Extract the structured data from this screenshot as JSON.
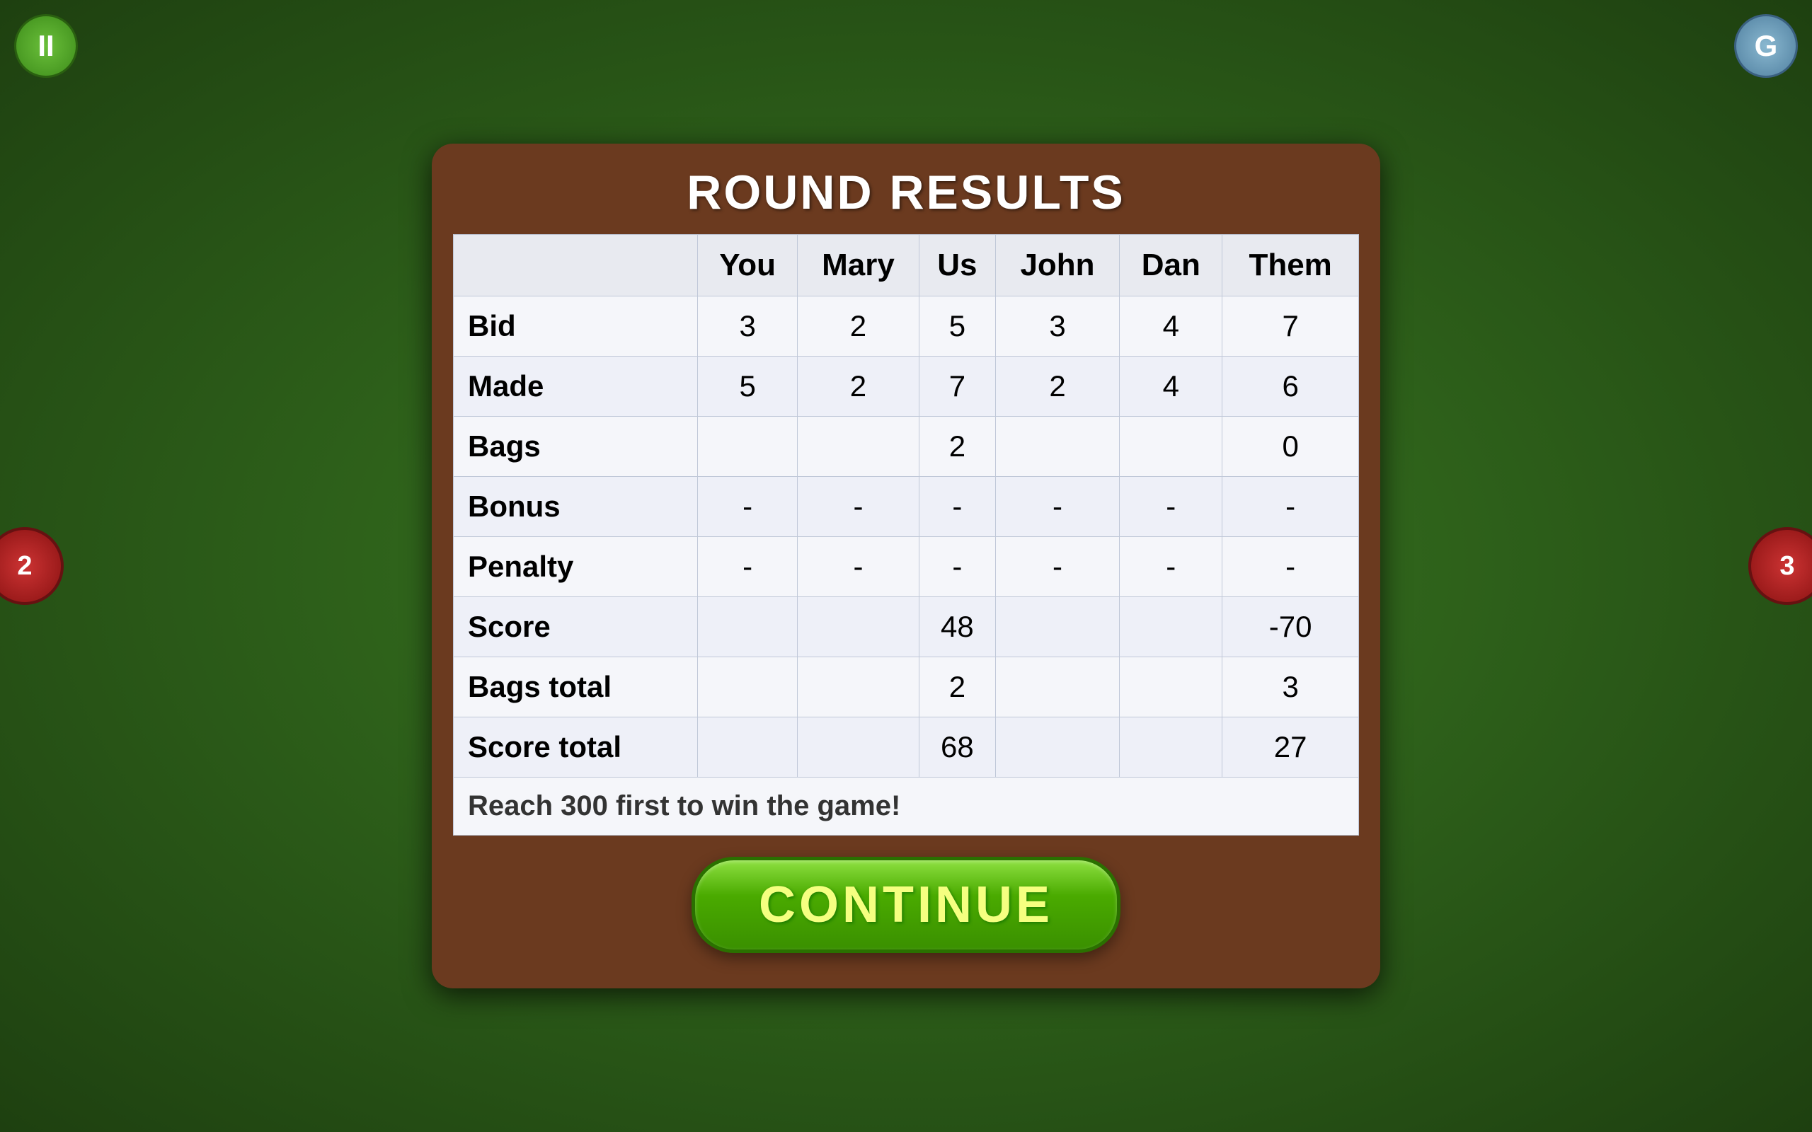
{
  "background": {
    "color": "#2d5a1b"
  },
  "corner_buttons": {
    "top_left": {
      "label": "II",
      "color": "#4aaa10"
    },
    "top_right": {
      "label": "G",
      "color": "#6090b0"
    }
  },
  "modal": {
    "title": "ROUND RESULTS",
    "table": {
      "headers": [
        "",
        "You",
        "Mary",
        "Us",
        "John",
        "Dan",
        "Them"
      ],
      "rows": [
        {
          "label": "Bid",
          "you": "3",
          "mary": "2",
          "us": "5",
          "john": "3",
          "dan": "4",
          "them": "7"
        },
        {
          "label": "Made",
          "you": "5",
          "mary": "2",
          "us": "7",
          "john": "2",
          "dan": "4",
          "them": "6"
        },
        {
          "label": "Bags",
          "you": "",
          "mary": "",
          "us": "2",
          "john": "",
          "dan": "",
          "them": "0"
        },
        {
          "label": "Bonus",
          "you": "-",
          "mary": "-",
          "us": "-",
          "john": "-",
          "dan": "-",
          "them": "-"
        },
        {
          "label": "Penalty",
          "you": "-",
          "mary": "-",
          "us": "-",
          "john": "-",
          "dan": "-",
          "them": "-"
        },
        {
          "label": "Score",
          "you": "",
          "mary": "",
          "us": "48",
          "john": "",
          "dan": "",
          "them": "-70"
        },
        {
          "label": "Bags total",
          "you": "",
          "mary": "",
          "us": "2",
          "john": "",
          "dan": "",
          "them": "3"
        },
        {
          "label": "Score total",
          "you": "",
          "mary": "",
          "us": "68",
          "john": "",
          "dan": "",
          "them": "27"
        }
      ]
    },
    "win_message": "Reach 300 first to win the game!",
    "continue_button": "CONTINUE"
  }
}
